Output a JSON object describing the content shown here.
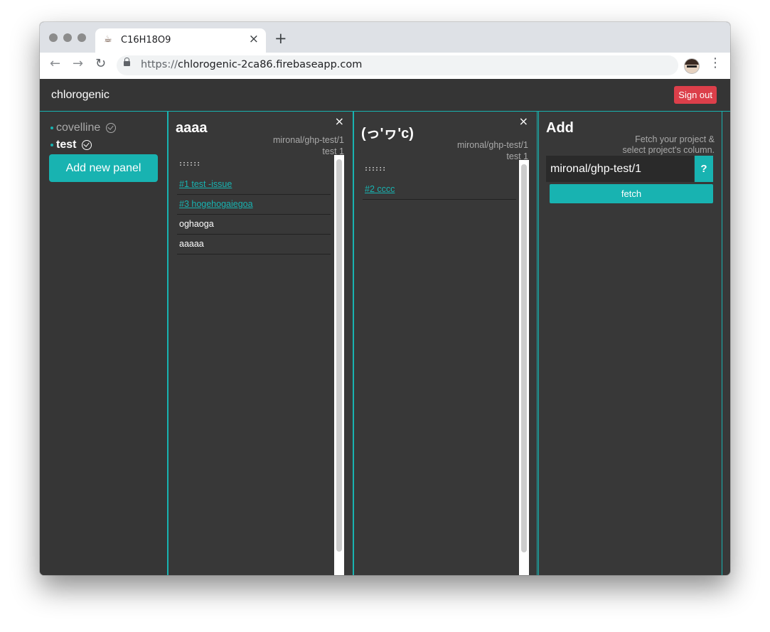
{
  "browser": {
    "tab_title": "C16H18O9",
    "tab_favicon": "☕",
    "tab_close": "×",
    "new_tab": "+",
    "url_scheme": "https://",
    "url_host": "chlorogenic-2ca86.firebaseapp.com"
  },
  "app": {
    "brand": "chlorogenic",
    "sign_out": "Sign out"
  },
  "sidebar": {
    "items": [
      {
        "label": "covelline",
        "active": false
      },
      {
        "label": "test",
        "active": true
      }
    ],
    "add_panel_label": "Add new panel"
  },
  "panels": [
    {
      "title": "aaaa",
      "repo": "mironal/ghp-test/1",
      "column": "test 1",
      "grip": "::::::",
      "cards": [
        {
          "text": "#1 test -issue",
          "link": true
        },
        {
          "text": "#3 hogehogaiegoa",
          "link": true
        },
        {
          "text": "oghaoga",
          "link": false
        },
        {
          "text": "aaaaa",
          "link": false
        }
      ]
    },
    {
      "title": "(っ'ヮ'c)",
      "repo": "mironal/ghp-test/1",
      "column": "test 1",
      "grip": "::::::",
      "cards": [
        {
          "text": "#2 cccc",
          "link": true
        }
      ]
    }
  ],
  "add_panel": {
    "title": "Add",
    "desc_line1": "Fetch your project &",
    "desc_line2": "select project's column.",
    "input_value": "mironal/ghp-test/1",
    "help_label": "?",
    "fetch_label": "fetch"
  },
  "colors": {
    "accent": "#18b3b1",
    "danger": "#dc3f4a",
    "background": "#383838",
    "link": "#18b3b1"
  },
  "icons": {
    "panel_close": "×",
    "star": "☆",
    "kebab": "⋮",
    "back": "←",
    "forward": "→",
    "reload": "↻"
  }
}
